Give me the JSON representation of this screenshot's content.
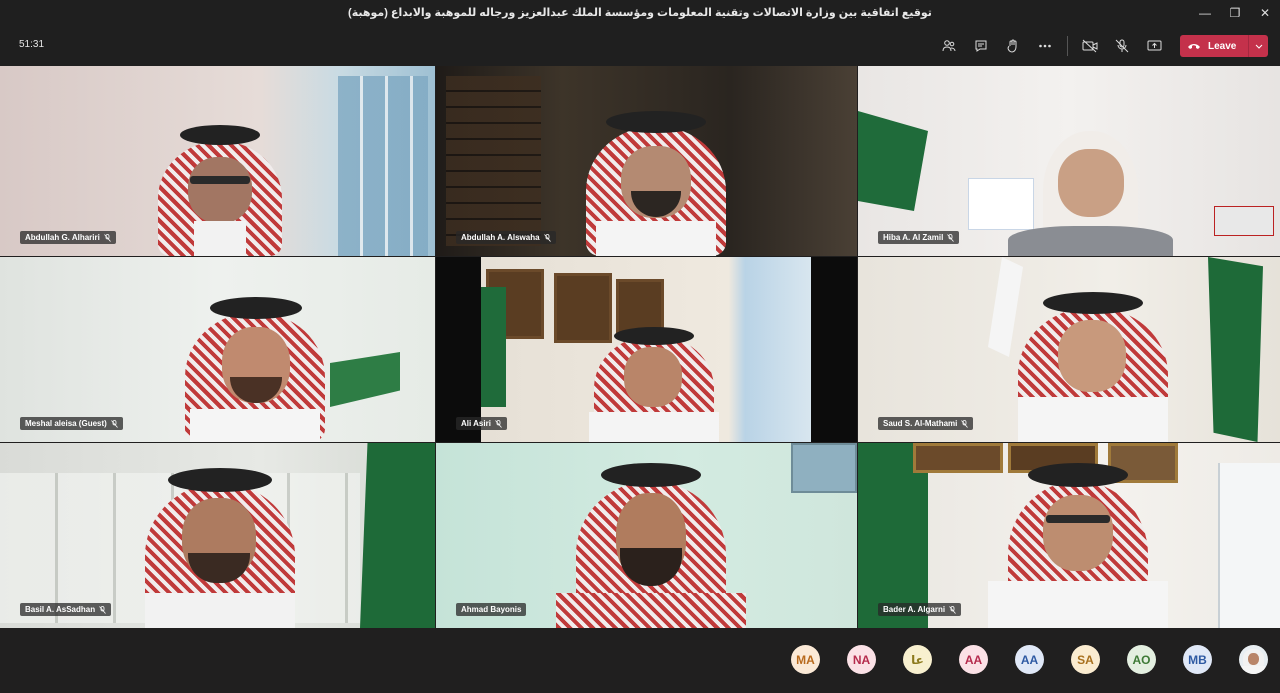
{
  "window": {
    "title": "توقيع اتفاقية بين وزارة الاتصالات وتقنية المعلومات ومؤسسة الملك عبدالعزيز ورجاله للموهبة والابداع (موهبة)"
  },
  "toolbar": {
    "timer": "51:31",
    "leave_label": "Leave"
  },
  "participants": [
    {
      "name": "Abdullah G. Alhariri"
    },
    {
      "name": "Abdullah A. Alswaha"
    },
    {
      "name": "Hiba A. Al Zamil"
    },
    {
      "name": "Meshal aleisa (Guest)"
    },
    {
      "name": "Ali Asiri"
    },
    {
      "name": "Saud S. Al-Mathami"
    },
    {
      "name": "Basil A. AsSadhan"
    },
    {
      "name": "Ahmad Bayonis"
    },
    {
      "name": "Bader A. Algarni"
    }
  ],
  "attendees": [
    {
      "initials": "MA",
      "bg": "#fbe9d6",
      "fg": "#b86a1d"
    },
    {
      "initials": "NA",
      "bg": "#fbe1e6",
      "fg": "#b52b4d"
    },
    {
      "initials": "عا",
      "bg": "#f8f0cf",
      "fg": "#8c7a1c"
    },
    {
      "initials": "AA",
      "bg": "#fbe1e6",
      "fg": "#b52b4d"
    },
    {
      "initials": "AA",
      "bg": "#e0e8f7",
      "fg": "#2f5aa3"
    },
    {
      "initials": "SA",
      "bg": "#fbecd0",
      "fg": "#a8701e"
    },
    {
      "initials": "AO",
      "bg": "#e3efe0",
      "fg": "#3d7a36"
    },
    {
      "initials": "MB",
      "bg": "#e0e8f7",
      "fg": "#2f5aa3"
    }
  ],
  "colors": {
    "leave": "#c4314b",
    "toolbar": "#1f1f1f",
    "shemagh_red": "#c03a3a"
  }
}
